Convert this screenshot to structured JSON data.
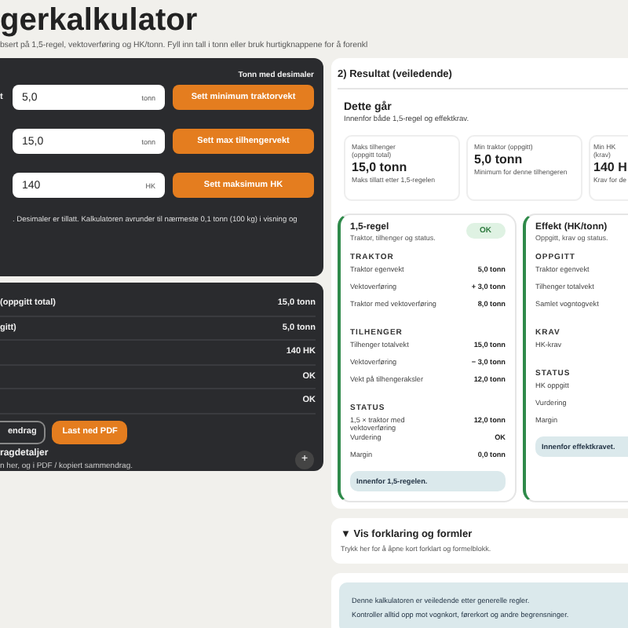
{
  "header": {
    "title": "gerkalkulator",
    "subtitle": "bsert på 1,5-regel, vektoverføring og HK/tonn. Fyll inn tall i tonn eller bruk hurtigknappene for å forenkl"
  },
  "inputs_card": {
    "hint": "Tonn med desimaler",
    "label_fragment": "t",
    "fields": [
      {
        "value": "5,0",
        "unit": "tonn",
        "button": "Sett minimum traktorvekt"
      },
      {
        "value": "15,0",
        "unit": "tonn",
        "button": "Sett max tilhengervekt"
      },
      {
        "value": "140",
        "unit": "HK",
        "button": "Sett maksimum HK"
      }
    ],
    "note": ". Desimaler er tillatt. Kalkulatoren avrunder til nærmeste 0,1 tonn (100 kg) i visning og"
  },
  "summary_card": {
    "rows": [
      {
        "label": "(oppgitt total)",
        "value": "15,0 tonn"
      },
      {
        "label": "gitt)",
        "value": "5,0 tonn"
      },
      {
        "value": "140 HK"
      },
      {
        "value": "OK"
      },
      {
        "value": "OK"
      }
    ],
    "buttons": [
      {
        "label": "endrag",
        "kind": "outline"
      },
      {
        "label": "Last ned PDF",
        "kind": "primary"
      }
    ],
    "details": {
      "title": "ragdetaljer",
      "text": "n her, og i PDF / kopiert sammendrag.",
      "toggle": "+"
    }
  },
  "result": {
    "title": "2) Resultat (veiledende)",
    "verdict": {
      "title": "Dette går",
      "text": "Innenfor både 1,5-regel og effektkrav."
    },
    "metrics": [
      {
        "label": "Maks tilhenger (oppgitt total)",
        "value": "15,0 tonn",
        "caption": "Maks tillatt etter 1,5-regelen"
      },
      {
        "label": "Min traktor (oppgitt)",
        "value": "5,0 tonn",
        "caption": "Minimum for denne tilhengeren"
      },
      {
        "label": "Min HK (krav)",
        "value": "140 H",
        "caption": "Krav for de"
      }
    ],
    "rules": [
      {
        "title": "1,5-regel",
        "subtitle": "Traktor, tilhenger og status.",
        "badge": "OK",
        "sections": [
          {
            "heading": "TRAKTOR",
            "rows": [
              {
                "label": "Traktor egenvekt",
                "value": "5,0 tonn"
              },
              {
                "label": "Vektoverføring",
                "value": "+ 3,0 tonn"
              },
              {
                "label": "Traktor med vektoverføring",
                "value": "8,0 tonn"
              }
            ]
          },
          {
            "heading": "TILHENGER",
            "rows": [
              {
                "label": "Tilhenger totalvekt",
                "value": "15,0 tonn"
              },
              {
                "label": "Vektoverføring",
                "value": "− 3,0 tonn"
              },
              {
                "label": "Vekt på tilhengeraksler",
                "value": "12,0 tonn"
              }
            ]
          },
          {
            "heading": "STATUS",
            "rows": [
              {
                "label": "1,5 × traktor med vektoverføring",
                "value": "12,0 tonn"
              },
              {
                "label": "Vurdering",
                "value": "OK"
              },
              {
                "label": "Margin",
                "value": "0,0 tonn"
              }
            ]
          }
        ],
        "note": "Innenfor 1,5-regelen."
      },
      {
        "title": "Effekt (HK/tonn)",
        "subtitle": "Oppgitt, krav og status.",
        "sections": [
          {
            "heading": "OPPGITT",
            "rows": [
              {
                "label": "Traktor egenvekt"
              },
              {
                "label": "Tilhenger totalvekt"
              },
              {
                "label": "Samlet vogntogvekt"
              }
            ]
          },
          {
            "heading": "KRAV",
            "rows": [
              {
                "label": "HK-krav"
              }
            ]
          },
          {
            "heading": "STATUS",
            "rows": [
              {
                "label": "HK oppgitt"
              },
              {
                "label": "Vurdering"
              },
              {
                "label": "Margin"
              }
            ]
          }
        ],
        "note": "Innenfor effektkravet."
      }
    ]
  },
  "explain": {
    "title": "▼ Vis forklaring og formler",
    "text": "Trykk her for å åpne kort forklart og formelblokk."
  },
  "disclaimer": {
    "lines": [
      "Denne kalkulatoren er veiledende etter generelle regler.",
      "Kontroller alltid opp mot vognkort, førerkort og andre begrensninger."
    ]
  }
}
